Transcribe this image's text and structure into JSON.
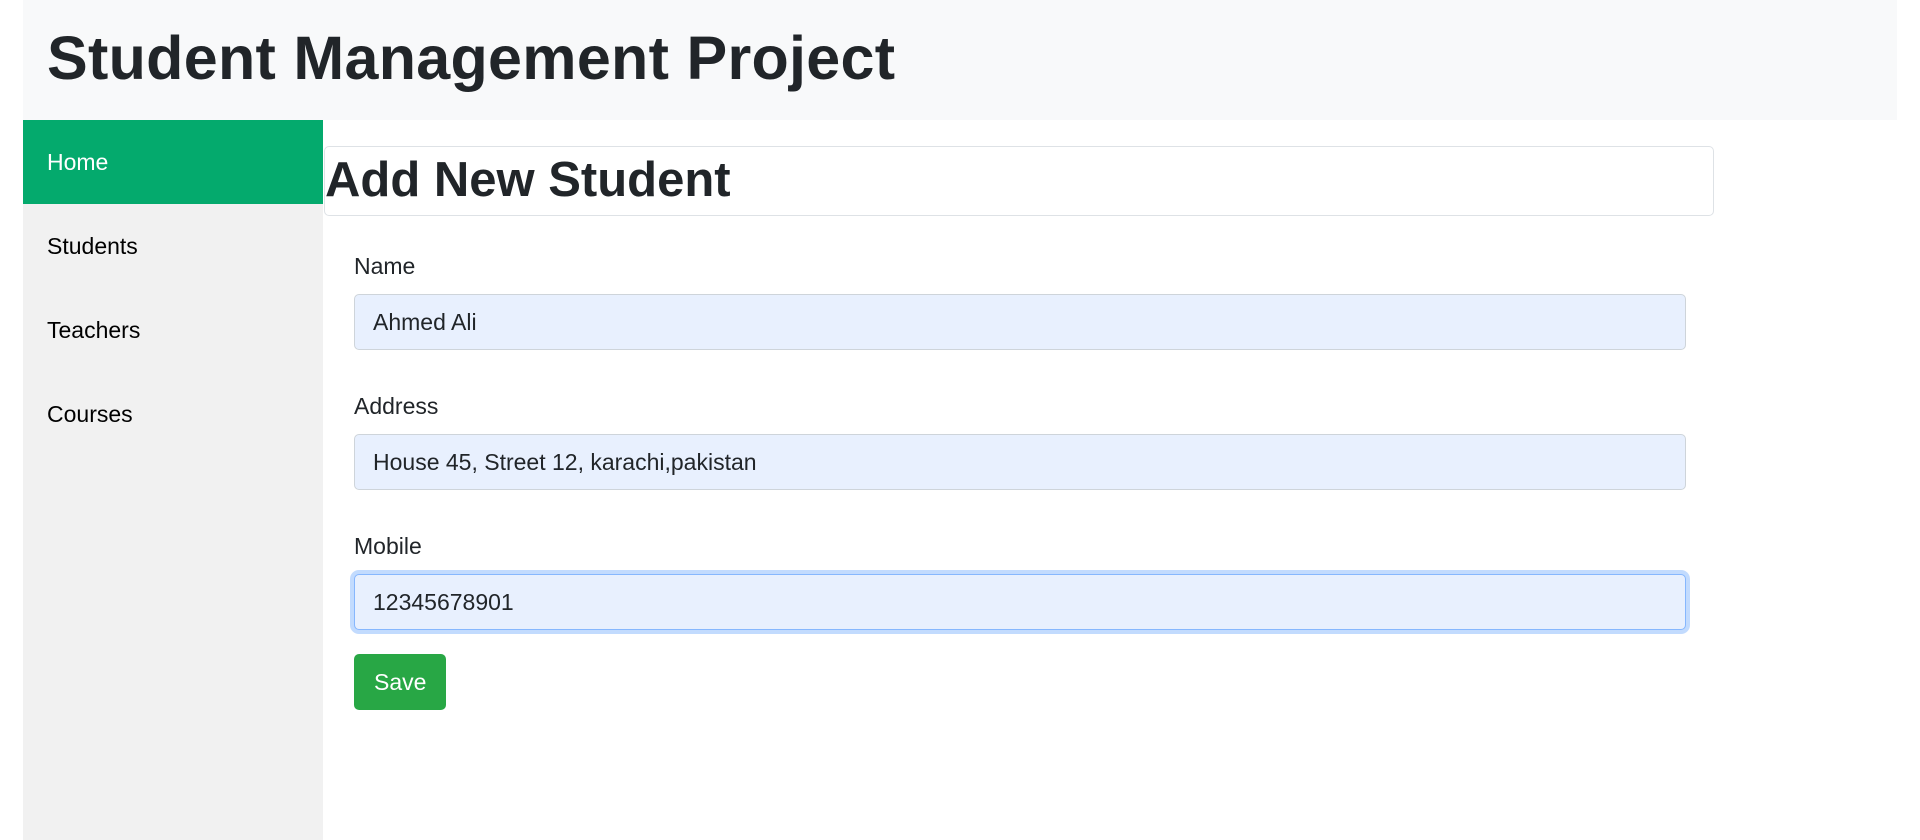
{
  "header": {
    "title": "Student Management Project"
  },
  "sidebar": {
    "items": [
      {
        "label": "Home"
      },
      {
        "label": "Students"
      },
      {
        "label": "Teachers"
      },
      {
        "label": "Courses"
      }
    ],
    "active_color": "#04aa6d"
  },
  "main": {
    "title": "Add New Student",
    "form": {
      "name_label": "Name",
      "name_value": "Ahmed Ali",
      "address_label": "Address",
      "address_value": "House 45, Street 12, karachi,pakistan",
      "mobile_label": "Mobile",
      "mobile_value": "12345678901",
      "save_label": "Save"
    }
  }
}
